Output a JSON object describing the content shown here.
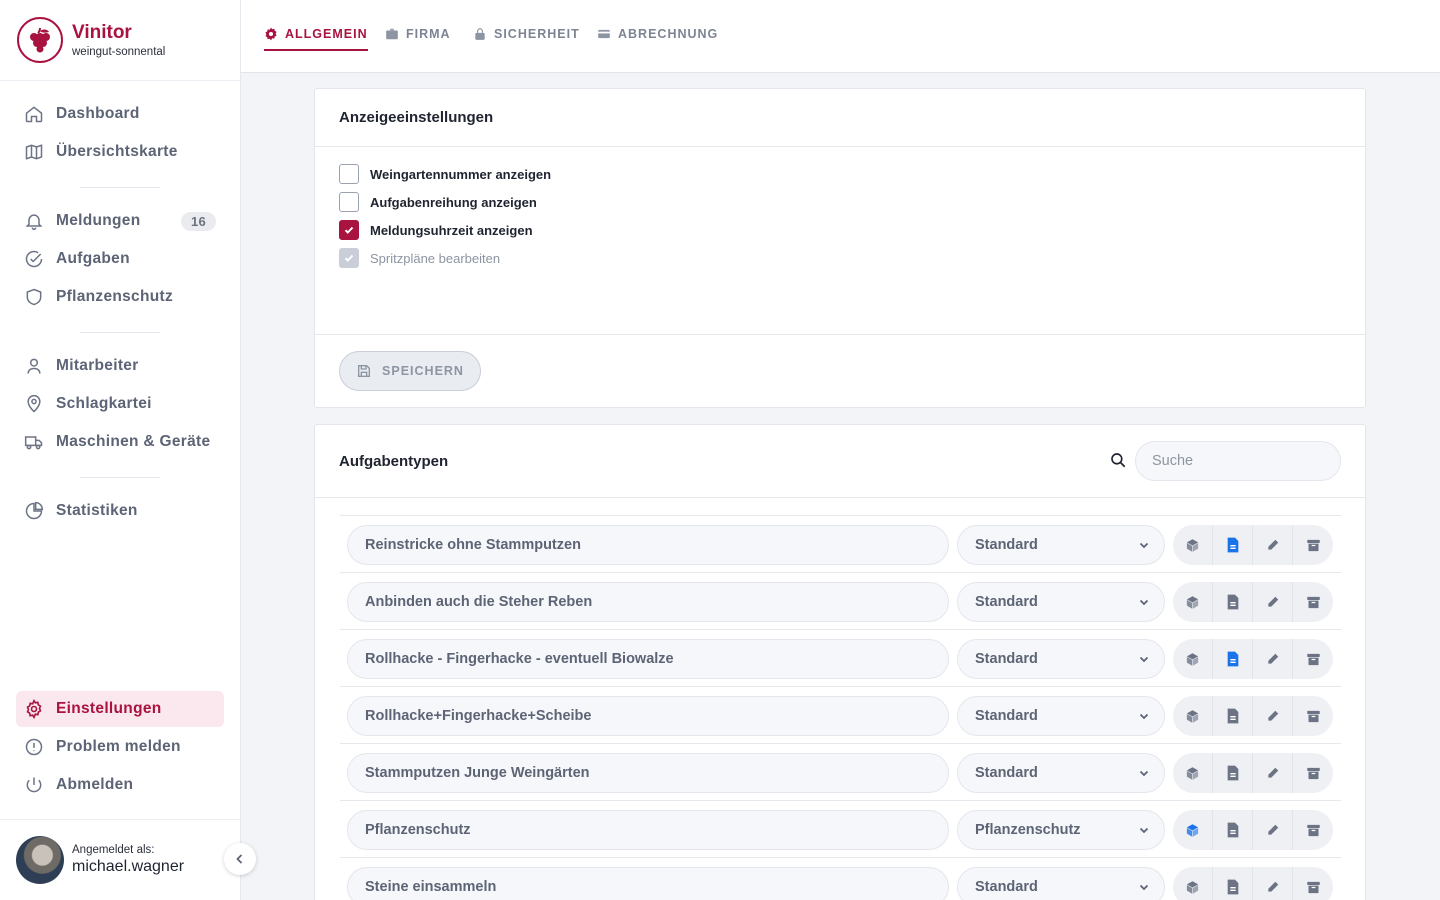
{
  "brand": {
    "name": "Vinitor",
    "subtitle": "weingut-sonnental"
  },
  "nav": {
    "dashboard": "Dashboard",
    "overview_map": "Übersichtskarte",
    "messages": "Meldungen",
    "messages_count": "16",
    "tasks": "Aufgaben",
    "plant_protection": "Pflanzenschutz",
    "employees": "Mitarbeiter",
    "field_registry": "Schlagkartei",
    "machines": "Maschinen & Geräte",
    "statistics": "Statistiken",
    "settings": "Einstellungen",
    "report_problem": "Problem melden",
    "logout": "Abmelden"
  },
  "user": {
    "label": "Angemeldet als:",
    "name": "michael.wagner"
  },
  "tabs": [
    {
      "label": "ALLGEMEIN",
      "icon": "gear-icon",
      "active": true
    },
    {
      "label": "FIRMA",
      "icon": "briefcase-icon",
      "active": false
    },
    {
      "label": "SICHERHEIT",
      "icon": "lock-icon",
      "active": false
    },
    {
      "label": "ABRECHNUNG",
      "icon": "credit-card-icon",
      "active": false
    }
  ],
  "display_settings": {
    "title": "Anzeigeeinstellungen",
    "options": [
      {
        "label": "Weingartennummer anzeigen",
        "checked": false,
        "disabled": false
      },
      {
        "label": "Aufgabenreihung anzeigen",
        "checked": false,
        "disabled": false
      },
      {
        "label": "Meldungsuhrzeit anzeigen",
        "checked": true,
        "disabled": false
      },
      {
        "label": "Spritzpläne bearbeiten",
        "checked": true,
        "disabled": true
      }
    ],
    "save_label": "SPEICHERN"
  },
  "task_types": {
    "title": "Aufgabentypen",
    "search_placeholder": "Suche",
    "rows": [
      {
        "name": "Reinstricke ohne Stammputzen",
        "type": "Standard",
        "cube_active": false,
        "doc_active": true
      },
      {
        "name": "Anbinden auch die Steher Reben",
        "type": "Standard",
        "cube_active": false,
        "doc_active": false
      },
      {
        "name": "Rollhacke - Fingerhacke - eventuell Biowalze",
        "type": "Standard",
        "cube_active": false,
        "doc_active": true
      },
      {
        "name": "Rollhacke+Fingerhacke+Scheibe",
        "type": "Standard",
        "cube_active": false,
        "doc_active": false
      },
      {
        "name": "Stammputzen Junge Weingärten",
        "type": "Standard",
        "cube_active": false,
        "doc_active": false
      },
      {
        "name": "Pflanzenschutz",
        "type": "Pflanzenschutz",
        "cube_active": true,
        "doc_active": false
      },
      {
        "name": "Steine einsammeln",
        "type": "Standard",
        "cube_active": false,
        "doc_active": false
      }
    ]
  },
  "colors": {
    "accent": "#a8133f",
    "active_icon": "#1a73e8",
    "muted": "#5c6475"
  }
}
